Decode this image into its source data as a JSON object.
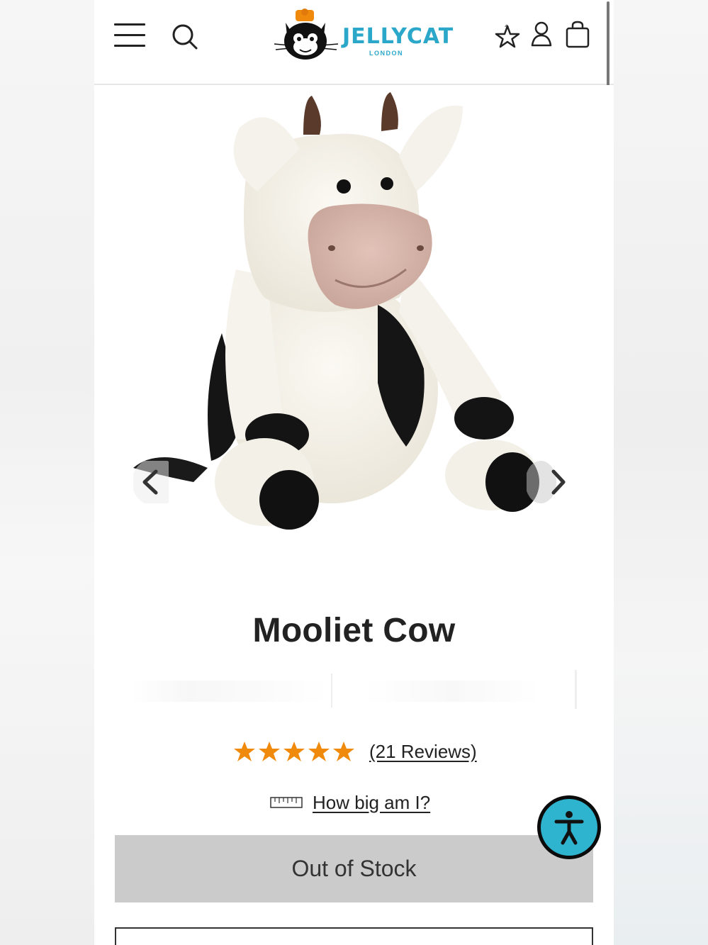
{
  "header": {
    "brand_name": "JELLYCAT",
    "brand_sub": "LONDON",
    "icons": [
      "menu-icon",
      "search-icon",
      "wishlist-icon",
      "account-icon",
      "bag-icon"
    ]
  },
  "product": {
    "title": "Mooliet Cow",
    "rating_stars": 5,
    "reviews_label": "(21 Reviews)",
    "size_label": "How big am I?",
    "stock_button_label": "Out of Stock"
  },
  "colors": {
    "brand": "#2aa7c9",
    "star": "#f08a0c",
    "accessibility": "#2fb4cf",
    "stock_button": "#cbcbcb"
  }
}
